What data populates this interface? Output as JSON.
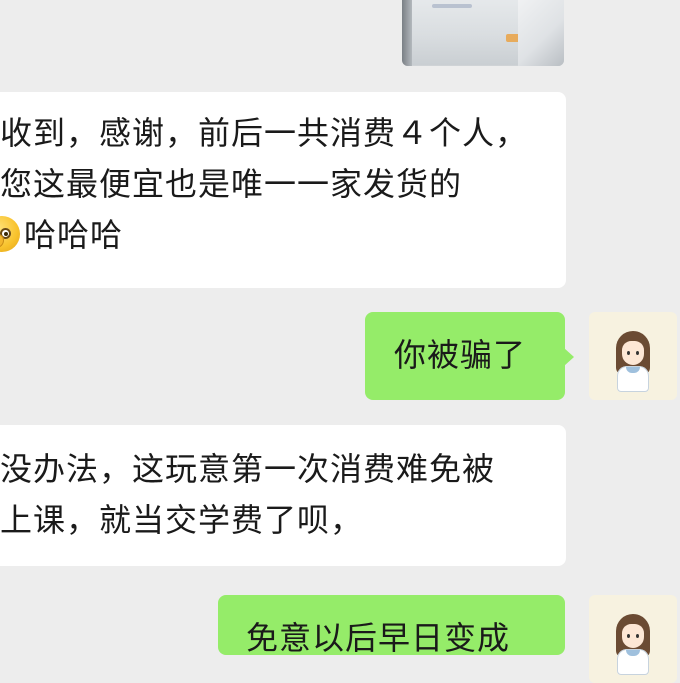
{
  "messages": [
    {
      "side": "left",
      "lines": [
        "收到，感谢，前后一共消费４个人，",
        "您这最便宜也是唯一一家发货的",
        "哈哈哈"
      ],
      "emoji": "wink-hand-emoji"
    },
    {
      "side": "right",
      "lines": [
        "你被骗了"
      ]
    },
    {
      "side": "left",
      "lines": [
        "没办法，这玩意第一次消费难免被",
        "上课，就当交学费了呗，"
      ]
    },
    {
      "side": "right",
      "lines": [
        "免意以后早日变成"
      ]
    }
  ],
  "colors": {
    "chat_bg": "#ededed",
    "incoming_bubble": "#ffffff",
    "outgoing_bubble": "#95ec69"
  },
  "avatar": {
    "icon": "girl-avatar-icon"
  },
  "image_message": {
    "icon": "photo-thumbnail-icon"
  }
}
